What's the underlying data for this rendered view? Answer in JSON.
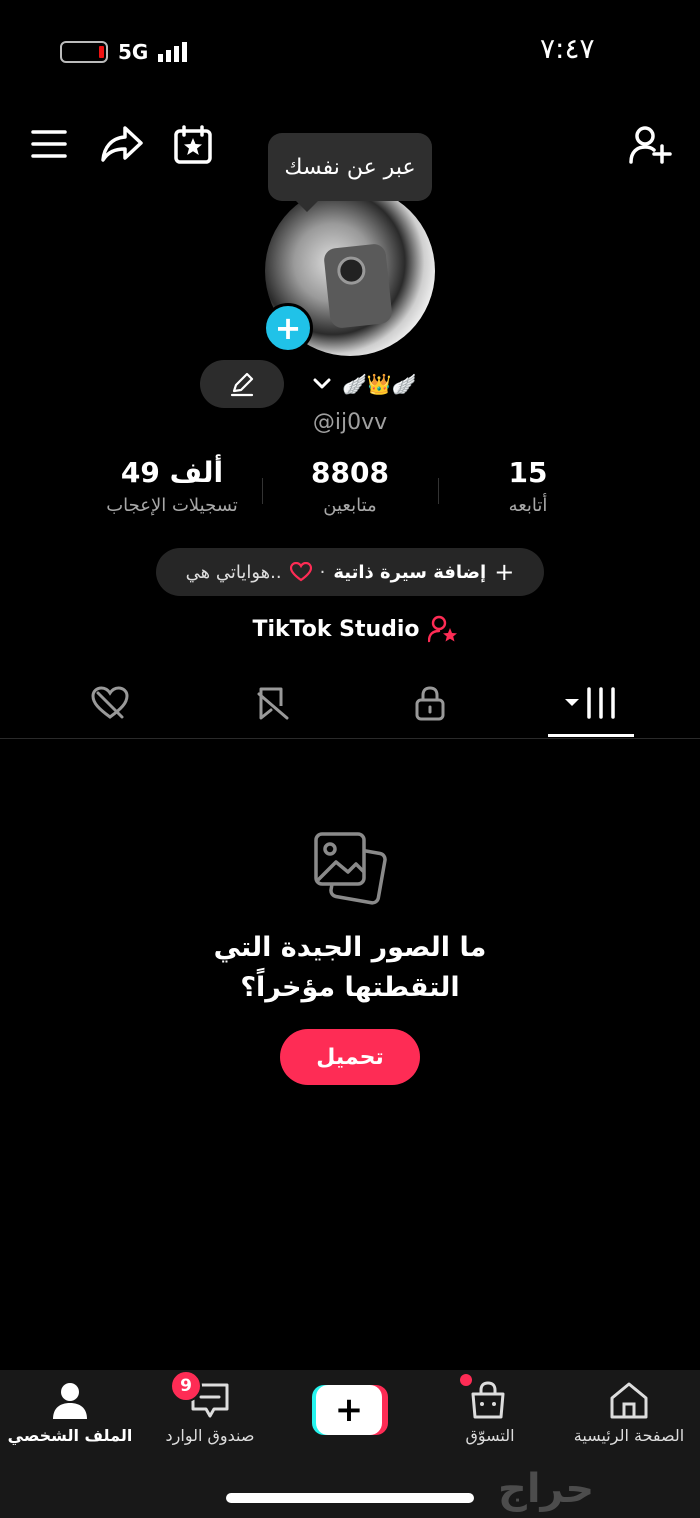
{
  "status_bar": {
    "time": "٧:٤٧",
    "network": "5G"
  },
  "header": {
    "tooltip": "عبر عن نفسك",
    "icons": [
      "menu-icon",
      "share-icon",
      "calendar-star-icon",
      "add-friend-icon"
    ]
  },
  "profile": {
    "display_name_icons": "🪽👑🪽",
    "username": "@ij0vv"
  },
  "stats": {
    "likes": {
      "value": "49 ألف",
      "label": "تسجيلات الإعجاب"
    },
    "followers": {
      "value": "8808",
      "label": "متابعين"
    },
    "following": {
      "value": "15",
      "label": "أتابعه"
    }
  },
  "bio": {
    "add_label": "إضافة سيرة ذاتية",
    "separator": "·",
    "hobbies": "هواياتي هي.."
  },
  "studio": {
    "label": "TikTok Studio"
  },
  "tabs": [
    "videos-grid-tab",
    "private-tab",
    "reposts-tab",
    "liked-tab"
  ],
  "empty_state": {
    "title": "ما الصور الجيدة التي التقطتها مؤخراً؟",
    "button": "تحميل"
  },
  "bottom_nav": {
    "home": "الصفحة الرئيسية",
    "shop": "التسوّق",
    "inbox": "صندوق الوارد",
    "inbox_badge": "9",
    "profile": "الملف الشخصي"
  },
  "watermark": "حراج",
  "colors": {
    "accent": "#fe2c55",
    "cyan": "#25f4ee",
    "avatar_add": "#20c2e8"
  }
}
